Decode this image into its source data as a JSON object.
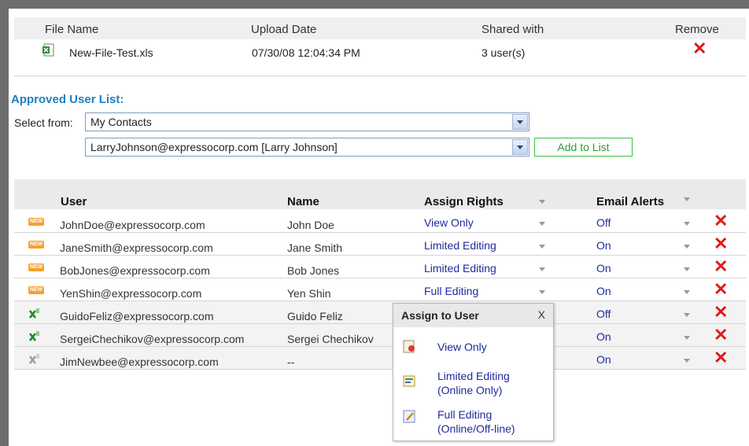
{
  "file_table": {
    "headers": {
      "file_name": "File Name",
      "upload_date": "Upload Date",
      "shared_with": "Shared with",
      "remove": "Remove"
    },
    "row": {
      "file_name": "New-File-Test.xls",
      "upload_date": "07/30/08 12:04:34 PM",
      "shared_with": "3 user(s)",
      "icon": "excel-file-icon"
    }
  },
  "approved": {
    "title": "Approved User List:",
    "select_from_label": "Select from:",
    "contacts_value": "My Contacts",
    "user_value": "LarryJohnson@expressocorp.com [Larry Johnson]",
    "add_button": "Add to List"
  },
  "users_table": {
    "headers": {
      "user": "User",
      "name": "Name",
      "rights": "Assign Rights",
      "alerts": "Email Alerts"
    },
    "rows": [
      {
        "user": "JohnDoe@expressocorp.com",
        "name": "John Doe",
        "rights": "View Only",
        "alerts": "Off",
        "badge": "NEW"
      },
      {
        "user": "JaneSmith@expressocorp.com",
        "name": "Jane Smith",
        "rights": "Limited Editing",
        "alerts": "On",
        "badge": "NEW"
      },
      {
        "user": "BobJones@expressocorp.com",
        "name": "Bob Jones",
        "rights": "Limited Editing",
        "alerts": "On",
        "badge": "NEW"
      },
      {
        "user": "YenShin@expressocorp.com",
        "name": "Yen Shin",
        "rights": "Full Editing",
        "alerts": "On",
        "badge": "NEW"
      },
      {
        "user": "GuidoFeliz@expressocorp.com",
        "name": "Guido Feliz",
        "rights": "",
        "alerts": "Off",
        "icon": "excel-user-icon"
      },
      {
        "user": "SergeiChechikov@expressocorp.com",
        "name": "Sergei Chechikov",
        "rights": "",
        "alerts": "On",
        "icon": "excel-user-icon"
      },
      {
        "user": "JimNewbee@expressocorp.com",
        "name": "--",
        "rights": "",
        "alerts": "On",
        "icon": "excel-user-disabled-icon"
      }
    ]
  },
  "popup": {
    "title": "Assign to User",
    "close": "X",
    "options": [
      {
        "line1": "View Only",
        "line2": "",
        "icon": "view-only-icon"
      },
      {
        "line1": "Limited Editing",
        "line2": "(Online Only)",
        "icon": "limited-editing-icon"
      },
      {
        "line1": "Full Editing",
        "line2": "(Online/Off-line)",
        "icon": "full-editing-icon"
      }
    ]
  },
  "colors": {
    "accent_blue": "#1f7fc0",
    "link_blue": "#1e2a9a",
    "remove_red": "#e01b1b",
    "button_green": "#2e9b2e",
    "new_badge": "#f6a12a"
  }
}
